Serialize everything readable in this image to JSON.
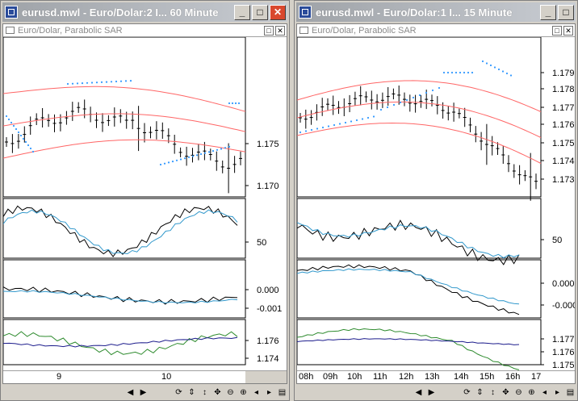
{
  "windows": [
    {
      "id": "left",
      "title": "eurusd.mwl - Euro/Dolar:2  I...  60 Minute",
      "chart_header": "Euro/Dolar, Parabolic SAR",
      "price_ticks": [
        "1.175",
        "1.170"
      ],
      "osc1_ticks": [
        "50"
      ],
      "osc2_ticks": [
        "0.000",
        "-0.001"
      ],
      "osc3_ticks": [
        "1.176",
        "1.174"
      ],
      "xaxis_labels": [
        "9",
        "10"
      ]
    },
    {
      "id": "right",
      "title": "eurusd.mwl - Euro/Dolar:1  I...  15 Minute",
      "chart_header": "Euro/Dolar, Parabolic SAR",
      "price_ticks": [
        "1.179",
        "1.178",
        "1.177",
        "1.176",
        "1.175",
        "1.174",
        "1.173"
      ],
      "osc1_ticks": [
        "50"
      ],
      "osc2_ticks": [
        "0.000",
        "-0.000"
      ],
      "osc3_ticks": [
        "1.177",
        "1.176",
        "1.175"
      ],
      "xaxis_labels": [
        "08h",
        "09h",
        "10h",
        "11h",
        "12h",
        "13h",
        "14h",
        "15h",
        "16h",
        "17"
      ]
    }
  ],
  "title_buttons": {
    "minimize": "_",
    "maximize": "□",
    "close": "✕"
  },
  "header_buttons": {
    "restore": "□",
    "close": "✕"
  },
  "status_icons": [
    "scroll-left-icon",
    "scroll-right-icon",
    "refresh-icon",
    "zoom-fit-icon",
    "vertical-move-icon",
    "pan-icon",
    "zoom-out-icon",
    "zoom-in-icon",
    "page-left-icon",
    "page-right-icon",
    "menu-icon"
  ],
  "colors": {
    "price_bars": "#000000",
    "bollinger": "#ff6666",
    "sar_dots": "#3399ff",
    "stoch_k": "#000000",
    "stoch_d": "#3399cc",
    "osc3_a": "#2e8b2e",
    "osc3_b": "#1c1c8c"
  }
}
